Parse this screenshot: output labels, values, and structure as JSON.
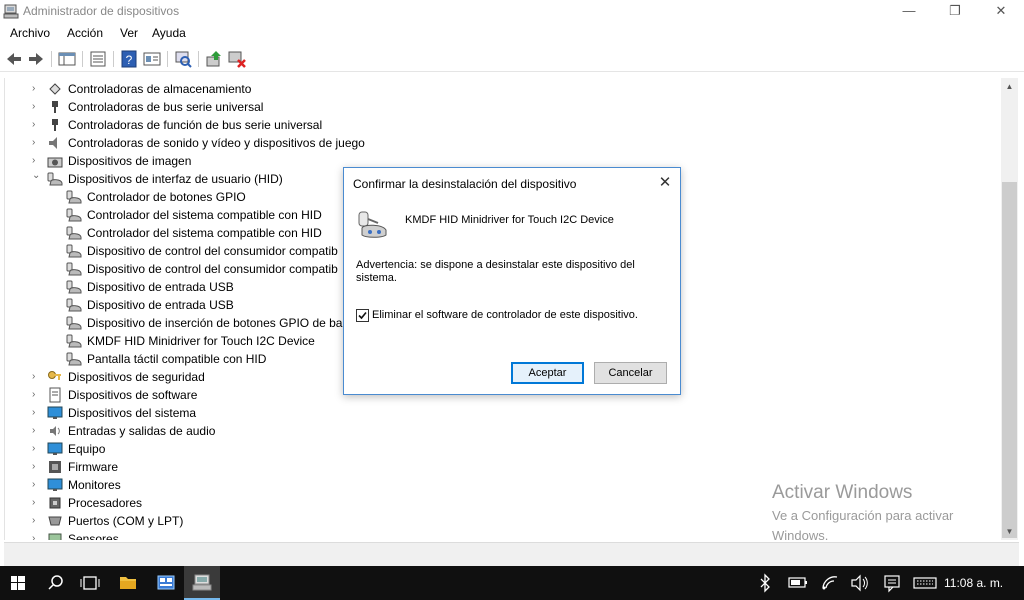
{
  "window": {
    "title": "Administrador de dispositivos",
    "minimize": "—",
    "maximize": "❐",
    "close": "✕"
  },
  "menu": [
    "Archivo",
    "Acción",
    "Ver",
    "Ayuda"
  ],
  "toolbar_icons": [
    "back-arrow-icon",
    "forward-arrow-icon",
    "properties-grid-icon",
    "list-view-icon",
    "help-icon",
    "properties-icon",
    "scan-hardware-icon",
    "update-driver-icon",
    "uninstall-device-icon"
  ],
  "tree": [
    {
      "label": "Controladoras de almacenamiento",
      "expander": "›",
      "icon": "storage-controller-icon",
      "level": 0
    },
    {
      "label": "Controladoras de bus serie universal",
      "expander": "›",
      "icon": "usb-icon",
      "level": 0
    },
    {
      "label": "Controladoras de función de bus serie universal",
      "expander": "›",
      "icon": "usb-icon",
      "level": 0
    },
    {
      "label": "Controladoras de sonido y vídeo y dispositivos de juego",
      "expander": "›",
      "icon": "speaker-icon",
      "level": 0
    },
    {
      "label": "Dispositivos de imagen",
      "expander": "›",
      "icon": "camera-icon",
      "level": 0
    },
    {
      "label": "Dispositivos de interfaz de usuario (HID)",
      "expander": "⌄",
      "icon": "hid-icon",
      "level": 0
    },
    {
      "label": "Controlador de botones GPIO",
      "expander": "",
      "icon": "hid-icon",
      "level": 1
    },
    {
      "label": "Controlador del sistema compatible con HID",
      "expander": "",
      "icon": "hid-icon",
      "level": 1
    },
    {
      "label": "Controlador del sistema compatible con HID",
      "expander": "",
      "icon": "hid-icon",
      "level": 1
    },
    {
      "label": "Dispositivo de control del consumidor compatib",
      "expander": "",
      "icon": "hid-icon",
      "level": 1
    },
    {
      "label": "Dispositivo de control del consumidor compatib",
      "expander": "",
      "icon": "hid-icon",
      "level": 1
    },
    {
      "label": "Dispositivo de entrada USB",
      "expander": "",
      "icon": "hid-icon",
      "level": 1
    },
    {
      "label": "Dispositivo de entrada USB",
      "expander": "",
      "icon": "hid-icon",
      "level": 1
    },
    {
      "label": "Dispositivo de inserción de botones GPIO de ban",
      "expander": "",
      "icon": "hid-icon",
      "level": 1
    },
    {
      "label": "KMDF HID Minidriver for Touch I2C Device",
      "expander": "",
      "icon": "hid-icon",
      "level": 1
    },
    {
      "label": "Pantalla táctil compatible con HID",
      "expander": "",
      "icon": "hid-icon",
      "level": 1
    },
    {
      "label": "Dispositivos de seguridad",
      "expander": "›",
      "icon": "key-icon",
      "level": 0
    },
    {
      "label": "Dispositivos de software",
      "expander": "›",
      "icon": "software-device-icon",
      "level": 0
    },
    {
      "label": "Dispositivos del sistema",
      "expander": "›",
      "icon": "monitor-icon",
      "level": 0
    },
    {
      "label": "Entradas y salidas de audio",
      "expander": "›",
      "icon": "audio-io-icon",
      "level": 0
    },
    {
      "label": "Equipo",
      "expander": "›",
      "icon": "monitor-icon",
      "level": 0
    },
    {
      "label": "Firmware",
      "expander": "›",
      "icon": "firmware-icon",
      "level": 0
    },
    {
      "label": "Monitores",
      "expander": "›",
      "icon": "monitor-icon",
      "level": 0
    },
    {
      "label": "Procesadores",
      "expander": "›",
      "icon": "processor-icon",
      "level": 0
    },
    {
      "label": "Puertos (COM y LPT)",
      "expander": "›",
      "icon": "port-icon",
      "level": 0
    },
    {
      "label": "Sensores",
      "expander": "›",
      "icon": "sensor-icon",
      "level": 0
    }
  ],
  "dialog": {
    "title": "Confirmar la desinstalación del dispositivo",
    "close": "✕",
    "device_name": "KMDF HID Minidriver for Touch I2C Device",
    "warning": "Advertencia: se dispone a desinstalar este dispositivo del sistema.",
    "checkbox_label": "Eliminar el software de controlador de este dispositivo.",
    "checkbox_checked": true,
    "ok": "Aceptar",
    "cancel": "Cancelar"
  },
  "watermark": {
    "title": "Activar Windows",
    "subtitle": "Ve a Configuración para activar Windows."
  },
  "taskbar": {
    "clock": "11:08 a. m.",
    "tray_icons": [
      "bluetooth-icon",
      "battery-icon",
      "wifi-icon",
      "volume-icon",
      "notification-icon",
      "keyboard-icon"
    ]
  },
  "colors": {
    "accent": "#0078d7",
    "dialog_border": "#4a8bd0",
    "taskbar": "#101010"
  }
}
